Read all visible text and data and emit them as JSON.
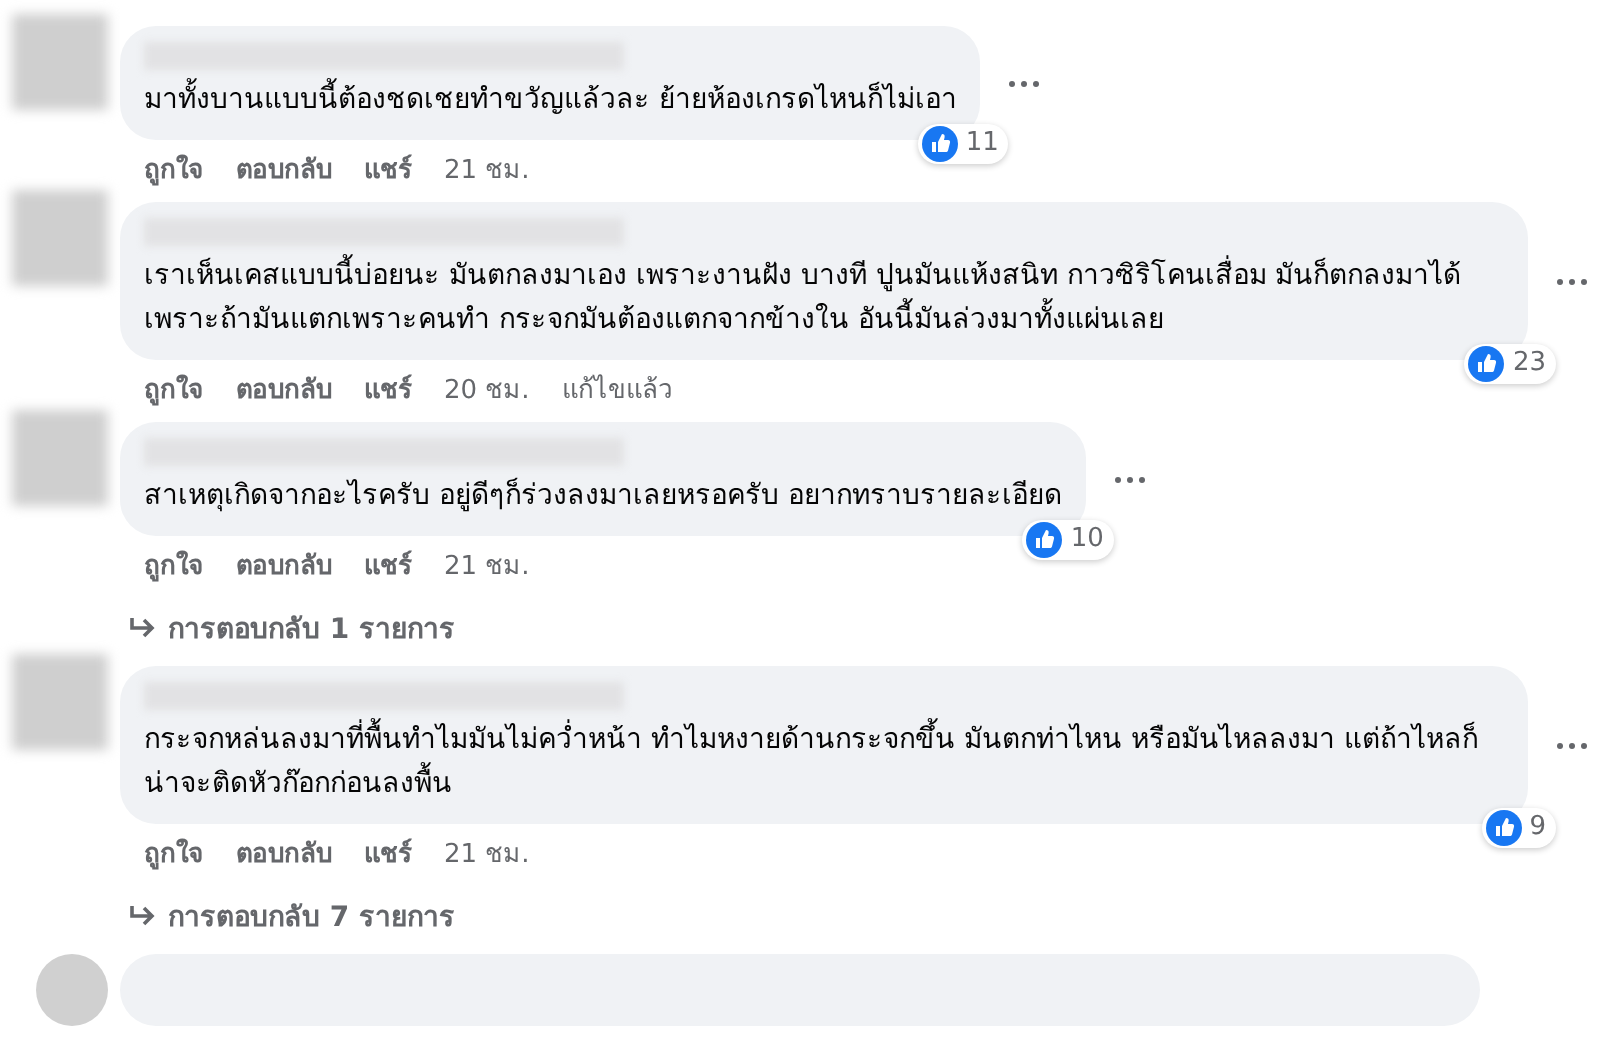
{
  "comments": [
    {
      "text": "มาทั้งบานแบบนี้ต้องชดเชยทำขวัญแล้วละ ย้ายห้องเกรดไหนก็ไม่เอา",
      "reactions": "11",
      "actions": [
        "ถูกใจ",
        "ตอบกลับ",
        "แชร์"
      ],
      "time": "21 ชม."
    },
    {
      "text": "เราเห็นเคสแบบนี้บ่อยนะ มันตกลงมาเอง เพราะงานฝัง บางที ปูนมันแห้งสนิท กาวซิริโคนเสื่อม มันก็ตกลงมาได้ เพราะถ้ามันแตกเพราะคนทำ กระจกมันต้องแตกจากข้างใน อันนี้มันล่วงมาทั้งแผ่นเลย",
      "reactions": "23",
      "actions": [
        "ถูกใจ",
        "ตอบกลับ",
        "แชร์"
      ],
      "time": "20 ชม.",
      "edited": "แก้ไขแล้ว"
    },
    {
      "text": "สาเหตุเกิดจากอะไรครับ อยู่ดีๆก็ร่วงลงมาเลยหรอครับ อยากทราบรายละเอียด",
      "reactions": "10",
      "actions": [
        "ถูกใจ",
        "ตอบกลับ",
        "แชร์"
      ],
      "time": "21 ชม.",
      "replies": "การตอบกลับ 1 รายการ"
    },
    {
      "text": "กระจกหล่นลงมาที่พื้นทำไมมันไม่คว่ำหน้า ทำไมหงายด้านกระจกขึ้น มันตกท่าไหน หรือมันไหลลงมา แต่ถ้าไหลก็น่าจะติดหัวก๊อกก่อนลงพื้น",
      "reactions": "9",
      "actions": [
        "ถูกใจ",
        "ตอบกลับ",
        "แชร์"
      ],
      "time": "21 ชม.",
      "replies": "การตอบกลับ 7 รายการ"
    }
  ]
}
